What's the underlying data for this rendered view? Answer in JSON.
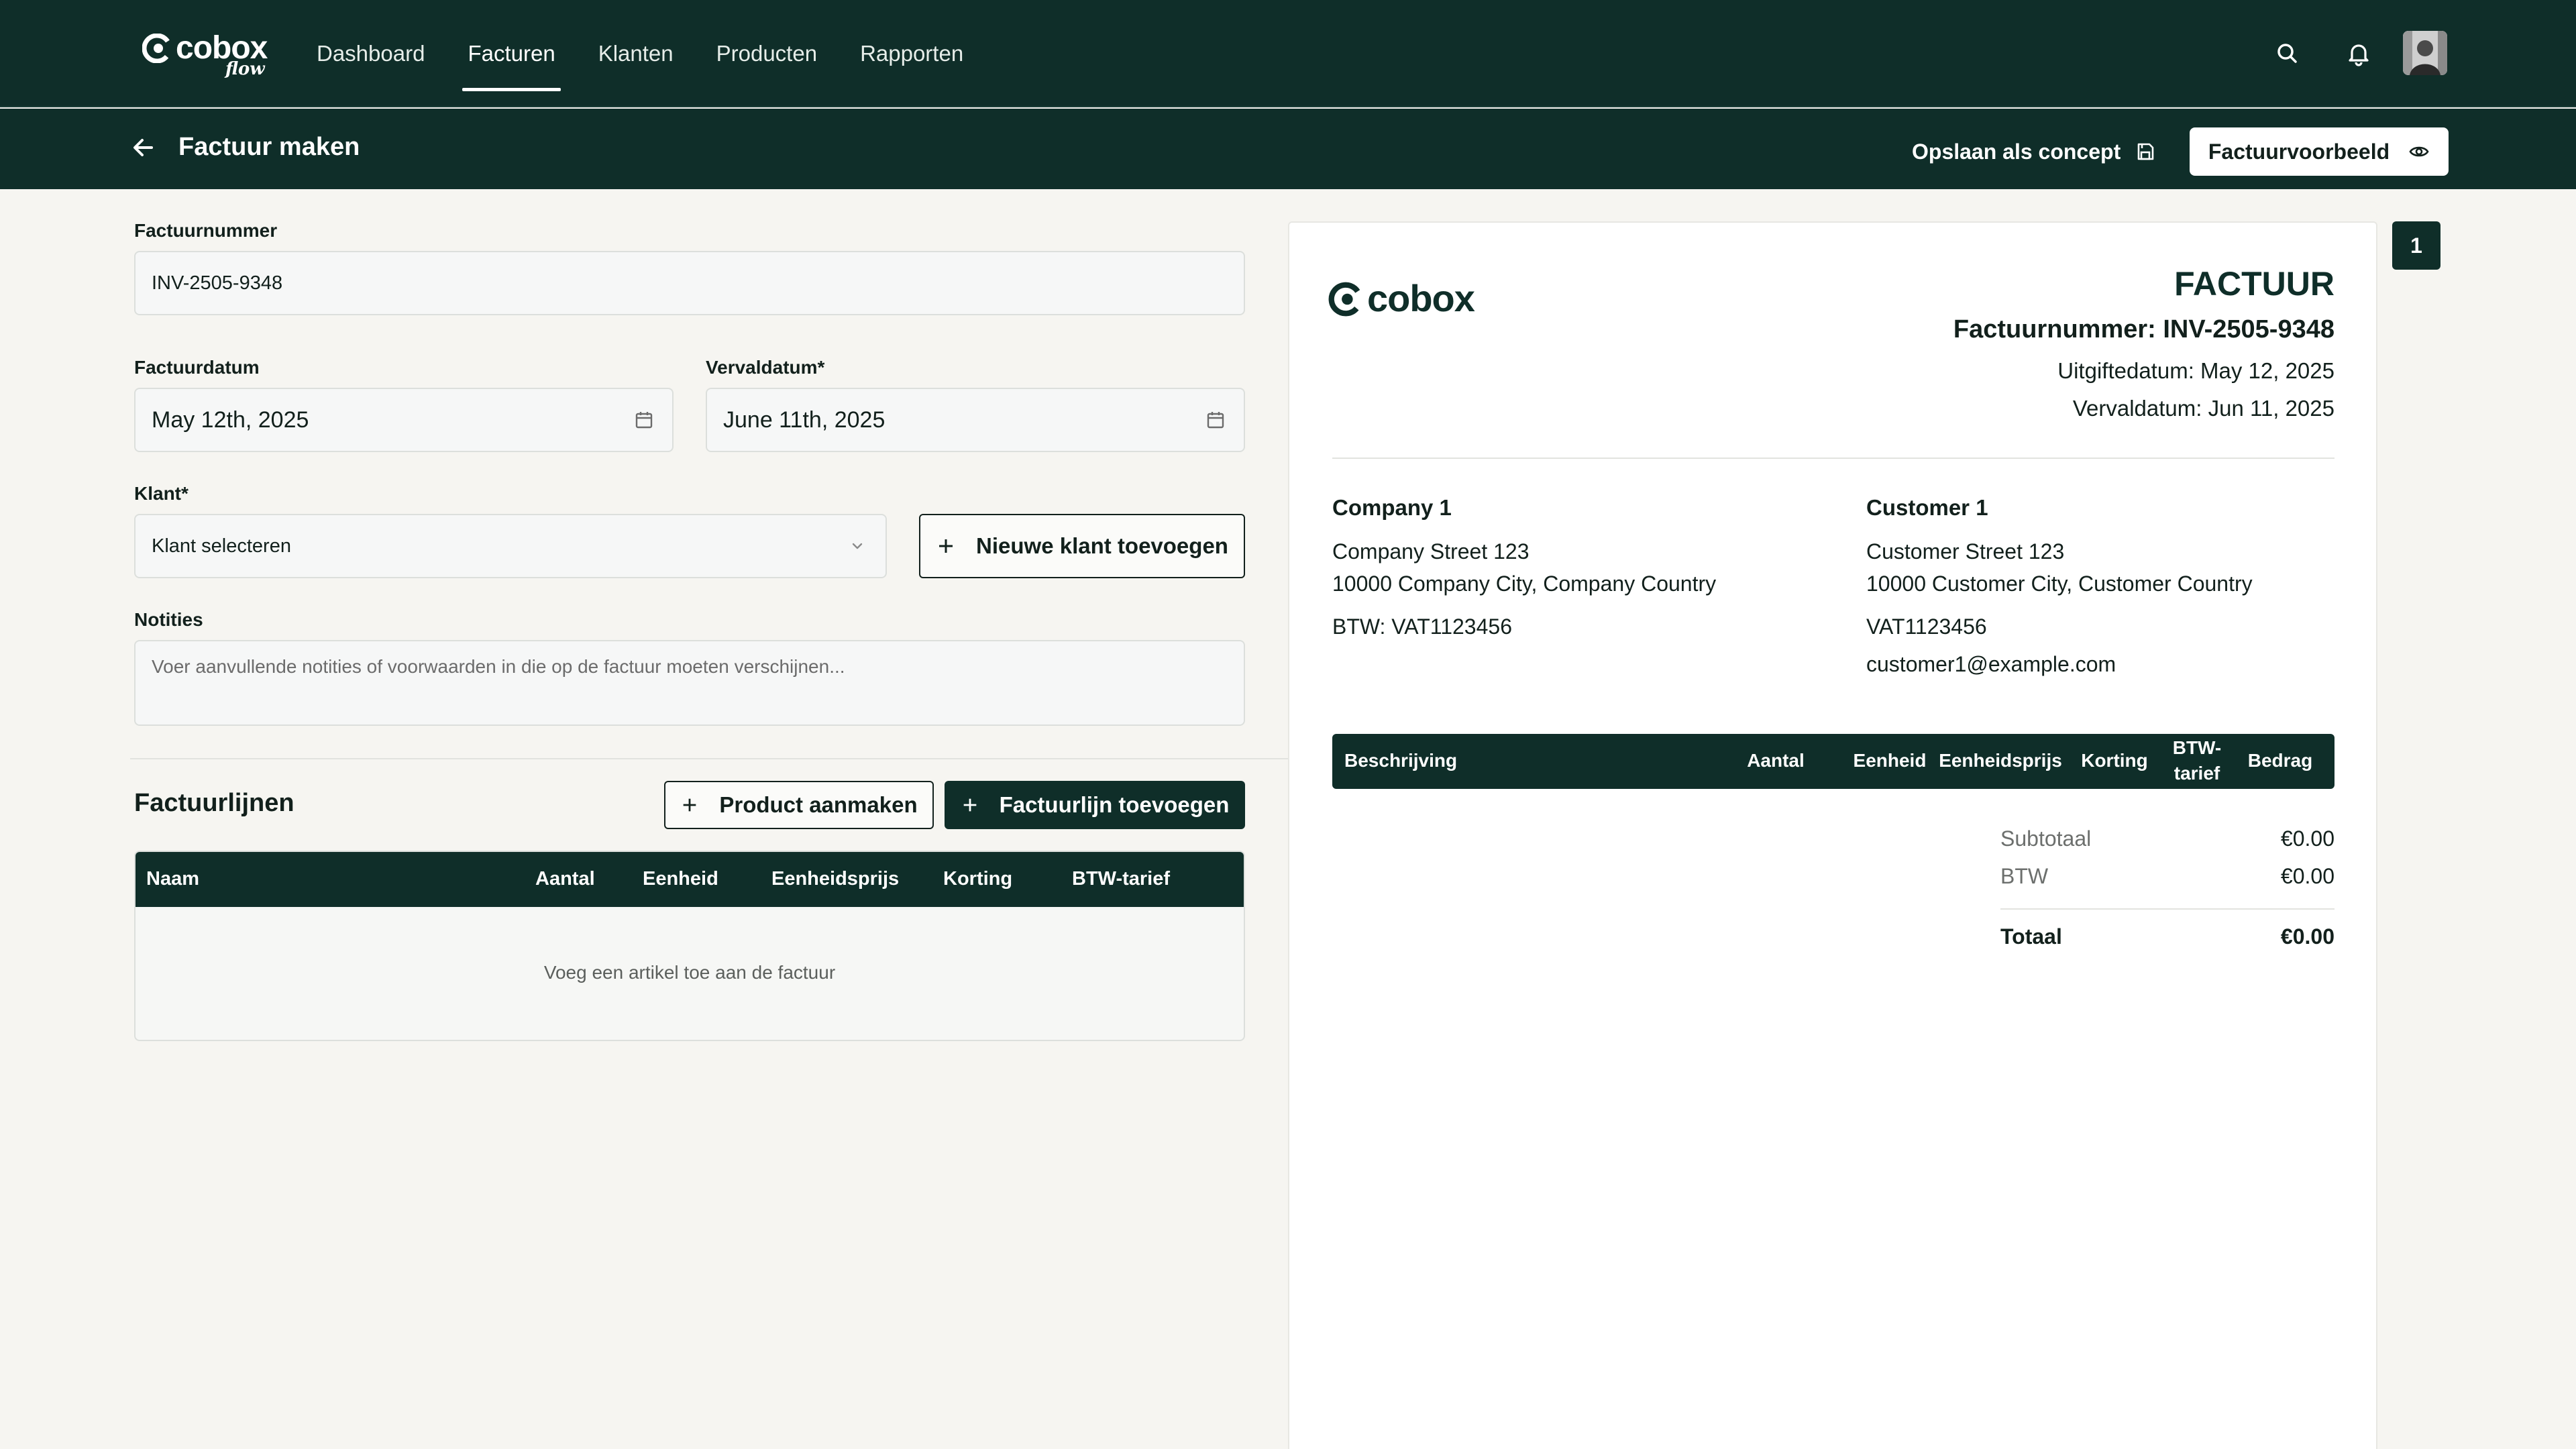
{
  "brand": {
    "name": "cobox",
    "sub": "flow",
    "preview_name": "cobox"
  },
  "nav": {
    "items": [
      {
        "label": "Dashboard"
      },
      {
        "label": "Facturen",
        "active": true
      },
      {
        "label": "Klanten"
      },
      {
        "label": "Producten"
      },
      {
        "label": "Rapporten"
      }
    ],
    "icons": [
      "search-icon",
      "bell-icon"
    ]
  },
  "subbar": {
    "title": "Factuur maken",
    "draft_label": "Opslaan als concept",
    "preview_label": "Factuurvoorbeeld"
  },
  "form": {
    "invoice_number_label": "Factuurnummer",
    "invoice_number_value": "INV-2505-9348",
    "invoice_date_label": "Factuurdatum",
    "invoice_date_value": "May 12th, 2025",
    "due_date_label": "Vervaldatum*",
    "due_date_value": "June 11th, 2025",
    "client_label": "Klant*",
    "client_placeholder": "Klant selecteren",
    "new_client_label": "Nieuwe klant toevoegen",
    "notes_label": "Notities",
    "notes_placeholder": "Voer aanvullende notities of voorwaarden in die op de factuur moeten verschijnen..."
  },
  "lines": {
    "title": "Factuurlijnen",
    "create_product_label": "Product aanmaken",
    "add_line_label": "Factuurlijn toevoegen",
    "columns": [
      "Naam",
      "Aantal",
      "Eenheid",
      "Eenheidsprijs",
      "Korting",
      "BTW-tarief"
    ],
    "empty_message": "Voeg een artikel toe aan de factuur"
  },
  "preview": {
    "page_number": "1",
    "title": "FACTUUR",
    "invoice_number": "Factuurnummer: INV-2505-9348",
    "issue_date": "Uitgiftedatum: May 12, 2025",
    "due_date": "Vervaldatum: Jun 11, 2025",
    "company": {
      "name": "Company 1",
      "street": "Company Street 123",
      "city": "10000 Company City, Company Country",
      "vat": "BTW: VAT1123456"
    },
    "customer": {
      "name": "Customer 1",
      "street": "Customer Street 123",
      "city": "10000 Customer City, Customer Country",
      "vat": "VAT1123456",
      "email": "customer1@example.com"
    },
    "columns": [
      "Beschrijving",
      "Aantal",
      "Eenheid",
      "Eenheidsprijs",
      "Korting",
      "BTW-tarief",
      "Bedrag"
    ],
    "subtotal_label": "Subtotaal",
    "subtotal_value": "€0.00",
    "vat_label": "BTW",
    "vat_value": "€0.00",
    "total_label": "Totaal",
    "total_value": "€0.00"
  },
  "colors": {
    "primary": "#0f2e29",
    "background": "#f6f5f1",
    "white": "#ffffff"
  }
}
